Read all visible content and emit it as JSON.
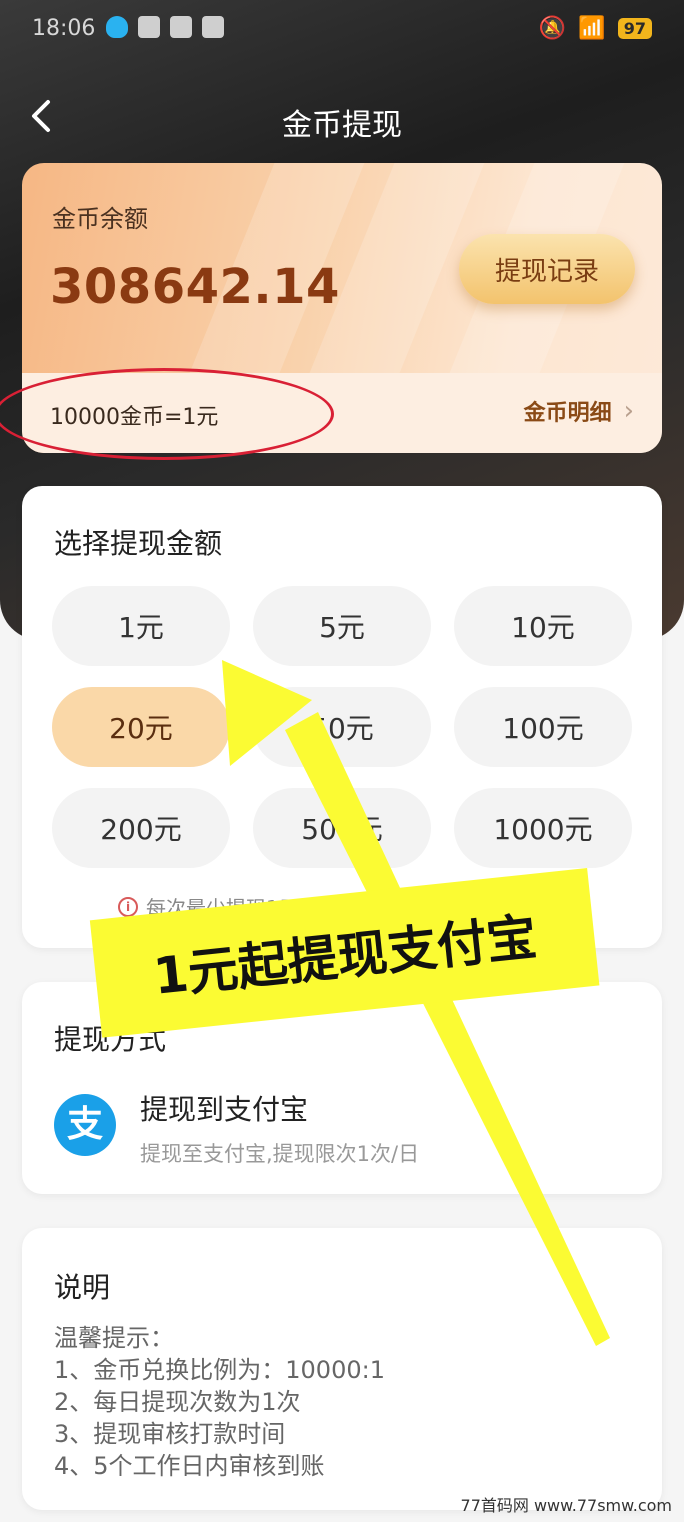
{
  "status_bar": {
    "time": "18:06",
    "battery": "97"
  },
  "nav": {
    "title": "金币提现"
  },
  "balance": {
    "label": "金币余额",
    "value": "308642.14",
    "record_button": "提现记录",
    "rate": "10000金币=1元",
    "detail_link": "金币明细"
  },
  "amounts": {
    "title": "选择提现金额",
    "options": [
      "1元",
      "5元",
      "10元",
      "20元",
      "50元",
      "100元",
      "200元",
      "500元",
      "1000元"
    ],
    "selected": "20元",
    "hint": "每次最少提现1元，每日次数不得超过1次"
  },
  "payment": {
    "title": "提现方式",
    "method_name": "提现到支付宝",
    "method_desc": "提现至支付宝,提现限次1次/日",
    "icon": "alipay-icon"
  },
  "notes": {
    "title": "说明",
    "lines": [
      "温馨提示：",
      "1、金币兑换比例为：10000:1",
      "2、每日提现次数为1次",
      "3、提现审核打款时间",
      "4、5个工作日内审核到账"
    ]
  },
  "overlay": {
    "banner_text": "1元起提现支付宝",
    "watermark": "77首码网 www.77smw.com",
    "highlight_color": "#d92035",
    "banner_color": "#fbfb33"
  }
}
